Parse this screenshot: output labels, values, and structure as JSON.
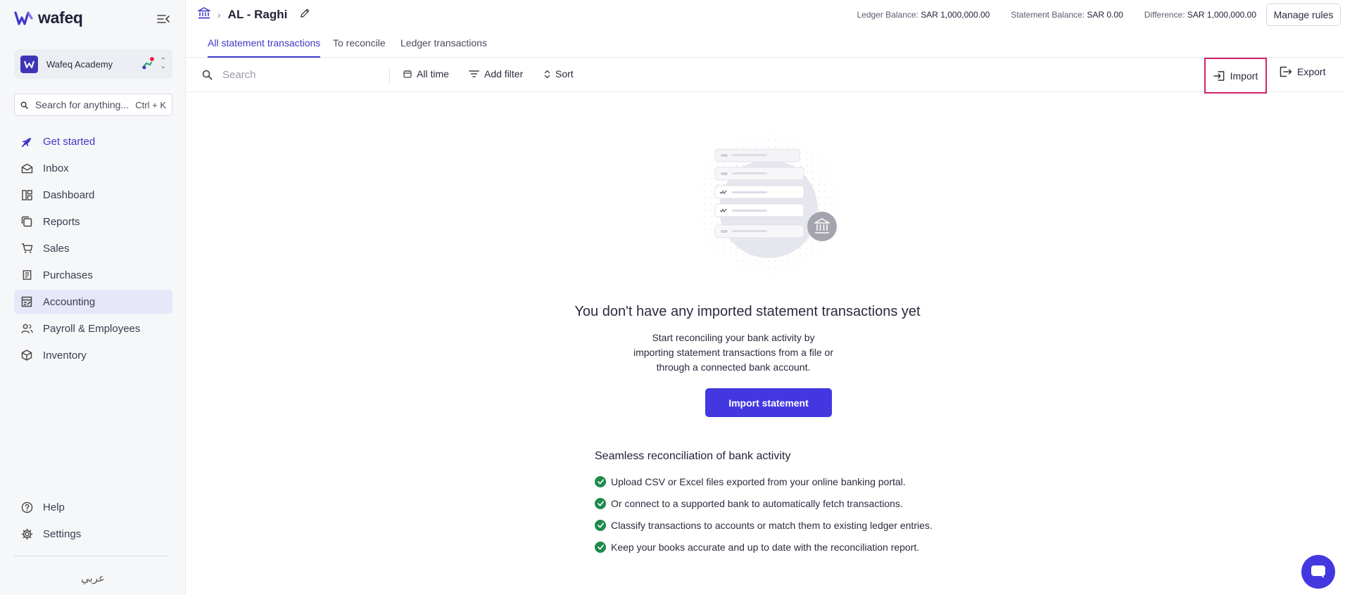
{
  "brand": {
    "name": "wafeq",
    "accent": "#3f38c8",
    "primary_button": "#4338e0"
  },
  "org": {
    "name": "Wafeq Academy"
  },
  "global_search": {
    "placeholder": "Search for anything...",
    "shortcut": "Ctrl + K"
  },
  "nav": [
    {
      "label": "Get started",
      "icon": "rocket-icon"
    },
    {
      "label": "Inbox",
      "icon": "inbox-icon"
    },
    {
      "label": "Dashboard",
      "icon": "dashboard-icon"
    },
    {
      "label": "Reports",
      "icon": "reports-icon"
    },
    {
      "label": "Sales",
      "icon": "cart-icon"
    },
    {
      "label": "Purchases",
      "icon": "receipt-icon"
    },
    {
      "label": "Accounting",
      "icon": "ledger-icon"
    },
    {
      "label": "Payroll & Employees",
      "icon": "people-icon"
    },
    {
      "label": "Inventory",
      "icon": "box-icon"
    }
  ],
  "bottom_nav": [
    {
      "label": "Help",
      "icon": "help-icon"
    },
    {
      "label": "Settings",
      "icon": "gear-icon"
    }
  ],
  "language_toggle": "عربي",
  "header": {
    "title": "AL - Raghi",
    "ledger_balance_label": "Ledger Balance:",
    "ledger_balance_value": "SAR 1,000,000.00",
    "statement_balance_label": "Statement Balance:",
    "statement_balance_value": "SAR 0.00",
    "difference_label": "Difference:",
    "difference_value": "SAR 1,000,000.00",
    "manage_rules": "Manage rules"
  },
  "tabs": [
    {
      "label": "All statement transactions",
      "active": true
    },
    {
      "label": "To reconcile",
      "active": false
    },
    {
      "label": "Ledger transactions",
      "active": false
    }
  ],
  "toolbar": {
    "search_placeholder": "Search",
    "date_filter": "All time",
    "add_filter": "Add filter",
    "sort": "Sort",
    "import": "Import",
    "export": "Export"
  },
  "empty_state": {
    "title": "You don't have any imported statement transactions yet",
    "description": "Start reconciling your bank activity by importing statement transactions from a file or through a connected bank account.",
    "cta": "Import statement",
    "features_title": "Seamless reconciliation of bank activity",
    "features": [
      "Upload CSV or Excel files exported from your online banking portal.",
      "Or connect to a supported bank to automatically fetch transactions.",
      "Classify transactions to accounts or match them to existing ledger entries.",
      "Keep your books accurate and up to date with the reconciliation report."
    ]
  }
}
